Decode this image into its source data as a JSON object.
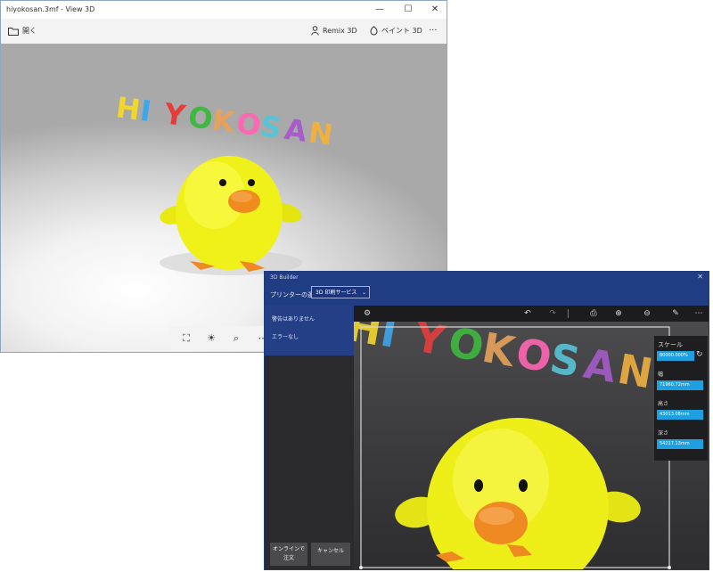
{
  "view3d": {
    "window_title": "hiyokosan.3mf - View 3D",
    "controls": {
      "minimize": "—",
      "maximize": "☐",
      "close": "✕"
    },
    "toolbar": {
      "open_label": "開く",
      "remix_label": "Remix 3D",
      "paint_label": "ペイント 3D",
      "more_label": "···"
    },
    "scene_text": "HIYOKOSAN",
    "letter_colors": [
      "#f2d62a",
      "#3ea6ea",
      "#e63c3c",
      "#3fb83f",
      "#e8a15a",
      "#ff66b3",
      "#58c4d8",
      "#a65cc9",
      "#f0b040"
    ],
    "bottom_icons": [
      "fit-view-icon",
      "lighting-icon",
      "zoom-icon",
      "more-icon"
    ]
  },
  "builder3d": {
    "window_title": "3D Builder",
    "close": "✕",
    "printer_label": "プリンターの選択",
    "printer_value": "3D 印刷サービス",
    "sidebar": {
      "line1": "警告はありません",
      "line2": "エラーなし"
    },
    "buttons": {
      "order": "オンラインで\n注文",
      "cancel": "キャンセル"
    },
    "scene_text": "HIYOKOSAN",
    "scale": {
      "heading": "スケール",
      "scale_value": "80000.000%",
      "width_label": "幅",
      "width_value": "71960.72mm",
      "height_label": "高さ",
      "height_value": "43013.08mm",
      "depth_label": "深さ",
      "depth_value": "54217.13mm"
    }
  }
}
